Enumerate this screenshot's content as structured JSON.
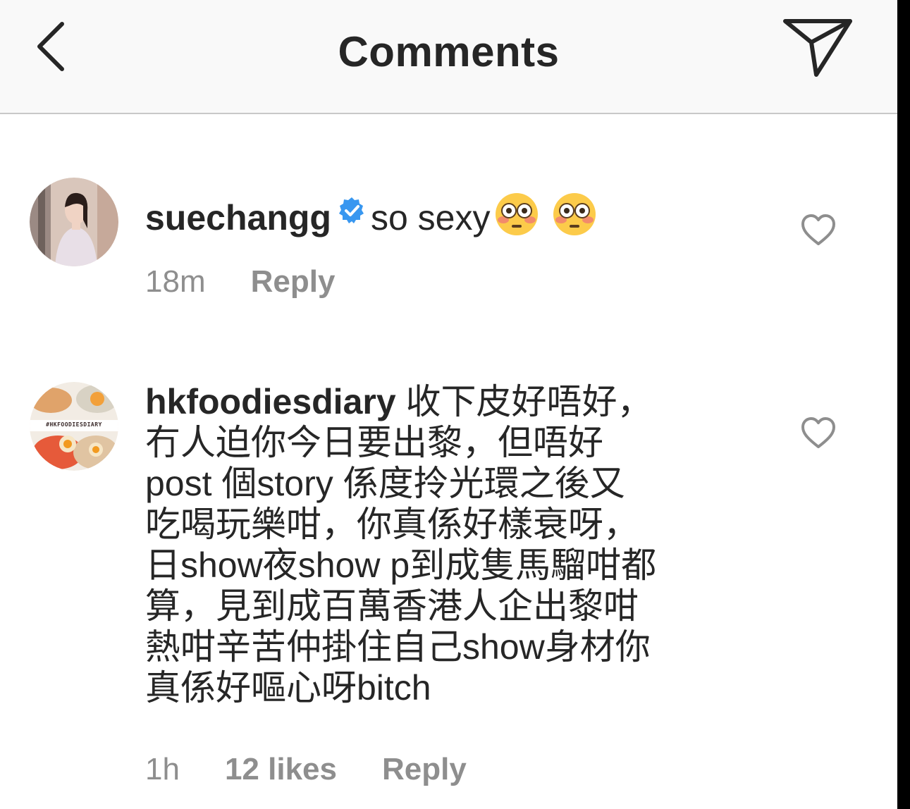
{
  "header": {
    "title": "Comments",
    "back_icon": "chevron-left-icon",
    "share_icon": "paper-plane-icon"
  },
  "comments": [
    {
      "username": "suechangg",
      "verified": true,
      "text": "so sexy",
      "emoji": [
        "flushed-face",
        "flushed-face"
      ],
      "time": "18m",
      "reply_label": "Reply"
    },
    {
      "username": "hkfoodiesdiary",
      "verified": false,
      "lines": [
        "收下皮好唔好，",
        "冇人迫你今日要出黎，但唔好",
        "post 個story 係度拎光環之後又",
        "吃喝玩樂咁，你真係好樣衰呀，",
        "日show夜show p到成隻馬騮咁都",
        "算，見到成百萬香港人企出黎咁",
        "熱咁辛苦仲掛住自己show身材你",
        "真係好嘔心呀bitch"
      ],
      "time": "1h",
      "likes": "12 likes",
      "reply_label": "Reply",
      "avatar_text": "#HKFOODIESDIARY"
    }
  ],
  "colors": {
    "text": "#262626",
    "secondary": "#8e8e8e",
    "verified": "#3897f0",
    "header_bg": "#f9f9f9"
  }
}
